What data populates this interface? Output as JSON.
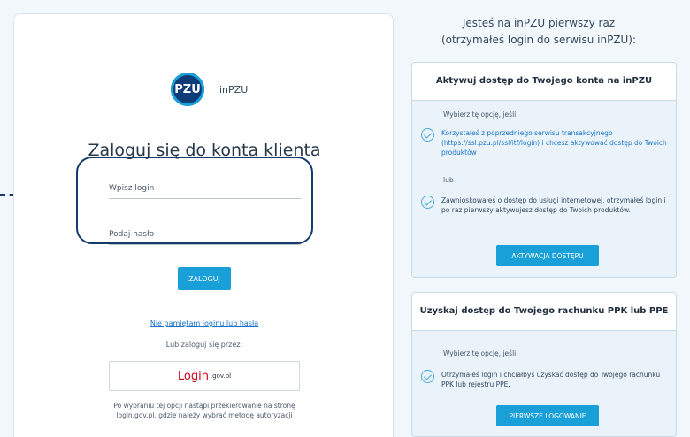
{
  "login": {
    "brand": "inPZU",
    "logo_text": "PZU",
    "title": "Zaloguj się do konta klienta",
    "login_placeholder": "Wpisz login",
    "password_placeholder": "Podaj hasło",
    "submit_label": "ZALOGUJ",
    "forgot_link": "Nie pamiętam loginu lub hasła",
    "or_text": "Lub zaloguj się przez:",
    "gov_login": "Login",
    "gov_domain": ".gov.pl",
    "gov_note": "Po wybraniu tej opcji nastąpi przekierowanie na stronę login.gov.pl, gdzie należy wybrać metodę autoryzacji"
  },
  "right": {
    "heading_line1": "Jesteś na inPZU pierwszy raz",
    "heading_line2": "(otrzymałeś login do serwisu inPZU):",
    "card1": {
      "title": "Aktywuj dostęp do Twojego konta na inPZU",
      "subtitle": "Wybierz tę opcję, jeśli:",
      "option1": "Korzystałeś z poprzedniego serwisu transakcyjnego (https://ssl.pzu.pl/ssl/itf/login) i chcesz aktywować dostęp do Twoich produktów",
      "or": "lub",
      "option2": "Zawnioskowałeś o dostęp do usługi internetowej, otrzymałeś login i po raz pierwszy aktywujesz dostęp do Twoich produktów.",
      "button": "AKTYWACJA DOSTĘPU"
    },
    "card2": {
      "title": "Uzyskaj dostęp do Twojego rachunku PPK lub PPE",
      "subtitle": "Wybierz tę opcję, jeśli:",
      "option1": "Otrzymałeś login i chciałbyś uzyskać dostęp do Twojego rachunku PPK lub rejestru PPE.",
      "button": "PIERWSZE LOGOWANIE"
    }
  },
  "colors": {
    "accent": "#1aa0d8",
    "navy": "#163a6a",
    "link": "#1a73c8"
  }
}
